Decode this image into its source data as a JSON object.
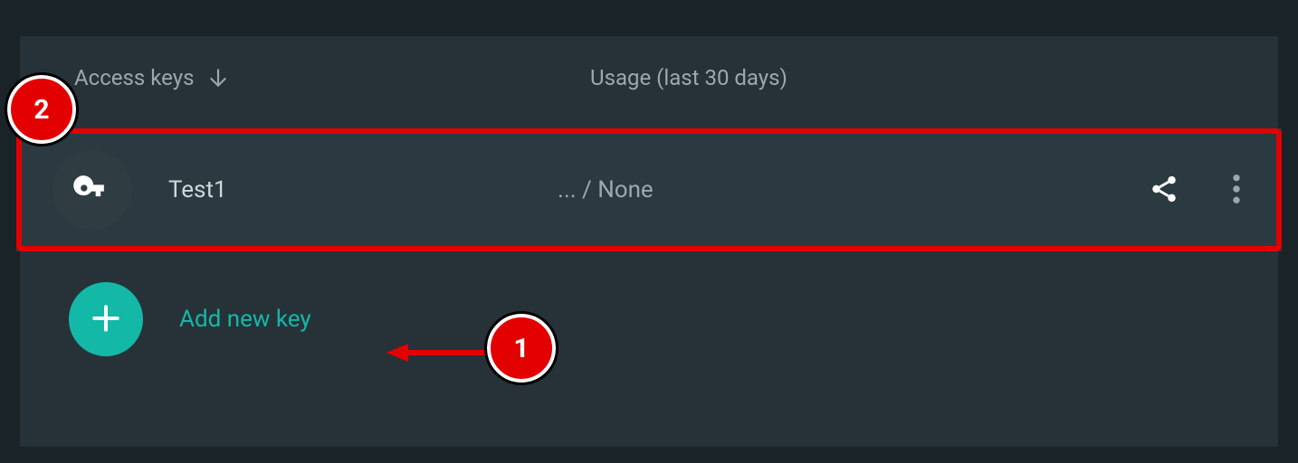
{
  "headers": {
    "access_keys": "Access keys",
    "usage": "Usage (last 30 days)"
  },
  "keys": [
    {
      "name": "Test1",
      "usage": "... / None"
    }
  ],
  "actions": {
    "add_new_key": "Add new key"
  },
  "annotations": {
    "marker1": "1",
    "marker2": "2"
  }
}
